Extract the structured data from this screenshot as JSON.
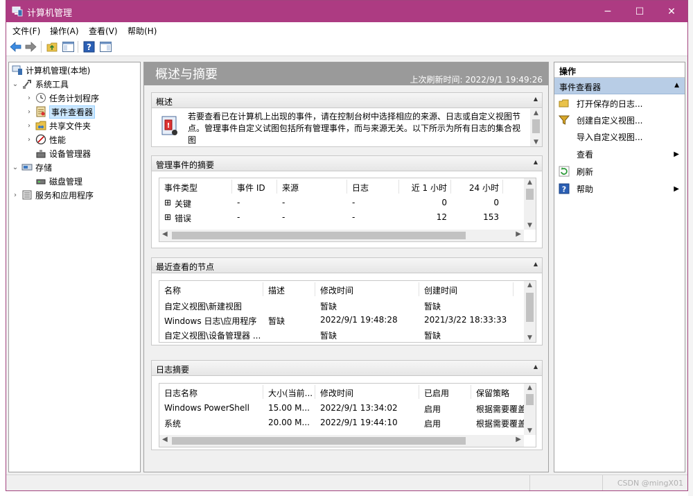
{
  "window": {
    "title": "计算机管理"
  },
  "menu": [
    "文件(F)",
    "操作(A)",
    "查看(V)",
    "帮助(H)"
  ],
  "tree": {
    "items": [
      {
        "label": "计算机管理(本地)",
        "level": 0,
        "expander": ""
      },
      {
        "label": "系统工具",
        "level": 1,
        "expander": "⌄"
      },
      {
        "label": "任务计划程序",
        "level": 2,
        "expander": "›"
      },
      {
        "label": "事件查看器",
        "level": 2,
        "expander": "›"
      },
      {
        "label": "共享文件夹",
        "level": 2,
        "expander": "›"
      },
      {
        "label": "性能",
        "level": 2,
        "expander": "›"
      },
      {
        "label": "设备管理器",
        "level": 2,
        "expander": ""
      },
      {
        "label": "存储",
        "level": 1,
        "expander": "⌄"
      },
      {
        "label": "磁盘管理",
        "level": 2,
        "expander": ""
      },
      {
        "label": "服务和应用程序",
        "level": 1,
        "expander": "›"
      }
    ]
  },
  "center": {
    "heading": "概述与摘要",
    "last_refresh": "上次刷新时间: 2022/9/1 19:49:26",
    "overview": {
      "title": "概述",
      "text": "若要查看已在计算机上出现的事件，请在控制台树中选择相应的来源、日志或自定义视图节点。管理事件自定义试图包括所有管理事件，而与来源无关。以下所示为所有日志的集合视图"
    },
    "admin_summary": {
      "title": "管理事件的摘要",
      "columns": [
        "事件类型",
        "事件 ID",
        "来源",
        "日志",
        "近 1 小时",
        "24 小时"
      ],
      "rows": [
        {
          "type": "关键",
          "id": "-",
          "source": "-",
          "log": "-",
          "h1": "0",
          "h24": "0"
        },
        {
          "type": "错误",
          "id": "-",
          "source": "-",
          "log": "-",
          "h1": "12",
          "h24": "153"
        }
      ]
    },
    "recent_nodes": {
      "title": "最近查看的节点",
      "columns": [
        "名称",
        "描述",
        "修改时间",
        "创建时间"
      ],
      "rows": [
        {
          "name": "自定义视图\\新建视图",
          "desc": "",
          "modified": "暂缺",
          "created": "暂缺"
        },
        {
          "name": "Windows 日志\\应用程序",
          "desc": "暂缺",
          "modified": "2022/9/1 19:48:28",
          "created": "2021/3/22 18:33:33"
        },
        {
          "name": "自定义视图\\设备管理器 ...",
          "desc": "",
          "modified": "暂缺",
          "created": "暂缺"
        }
      ]
    },
    "log_summary": {
      "title": "日志摘要",
      "columns": [
        "日志名称",
        "大小(当前...",
        "修改时间",
        "已启用",
        "保留策略"
      ],
      "rows": [
        {
          "name": "Windows PowerShell",
          "size": "15.00 M...",
          "modified": "2022/9/1 13:34:02",
          "enabled": "启用",
          "policy": "根据需要覆盖"
        },
        {
          "name": "系统",
          "size": "20.00 M...",
          "modified": "2022/9/1 19:44:10",
          "enabled": "启用",
          "policy": "根据需要覆盖"
        }
      ]
    }
  },
  "actions": {
    "title": "操作",
    "section": "事件查看器",
    "items": [
      {
        "label": "打开保存的日志...",
        "submenu": ""
      },
      {
        "label": "创建自定义视图...",
        "submenu": ""
      },
      {
        "label": "导入自定义视图...",
        "submenu": ""
      },
      {
        "label": "查看",
        "submenu": "▶"
      },
      {
        "label": "刷新",
        "submenu": ""
      },
      {
        "label": "帮助",
        "submenu": "▶"
      }
    ]
  },
  "watermark": "CSDN @mingX01",
  "colors": {
    "titlebar": "#ad3b82",
    "selected": "#cce8ff",
    "actions_header": "#b8cde6"
  }
}
